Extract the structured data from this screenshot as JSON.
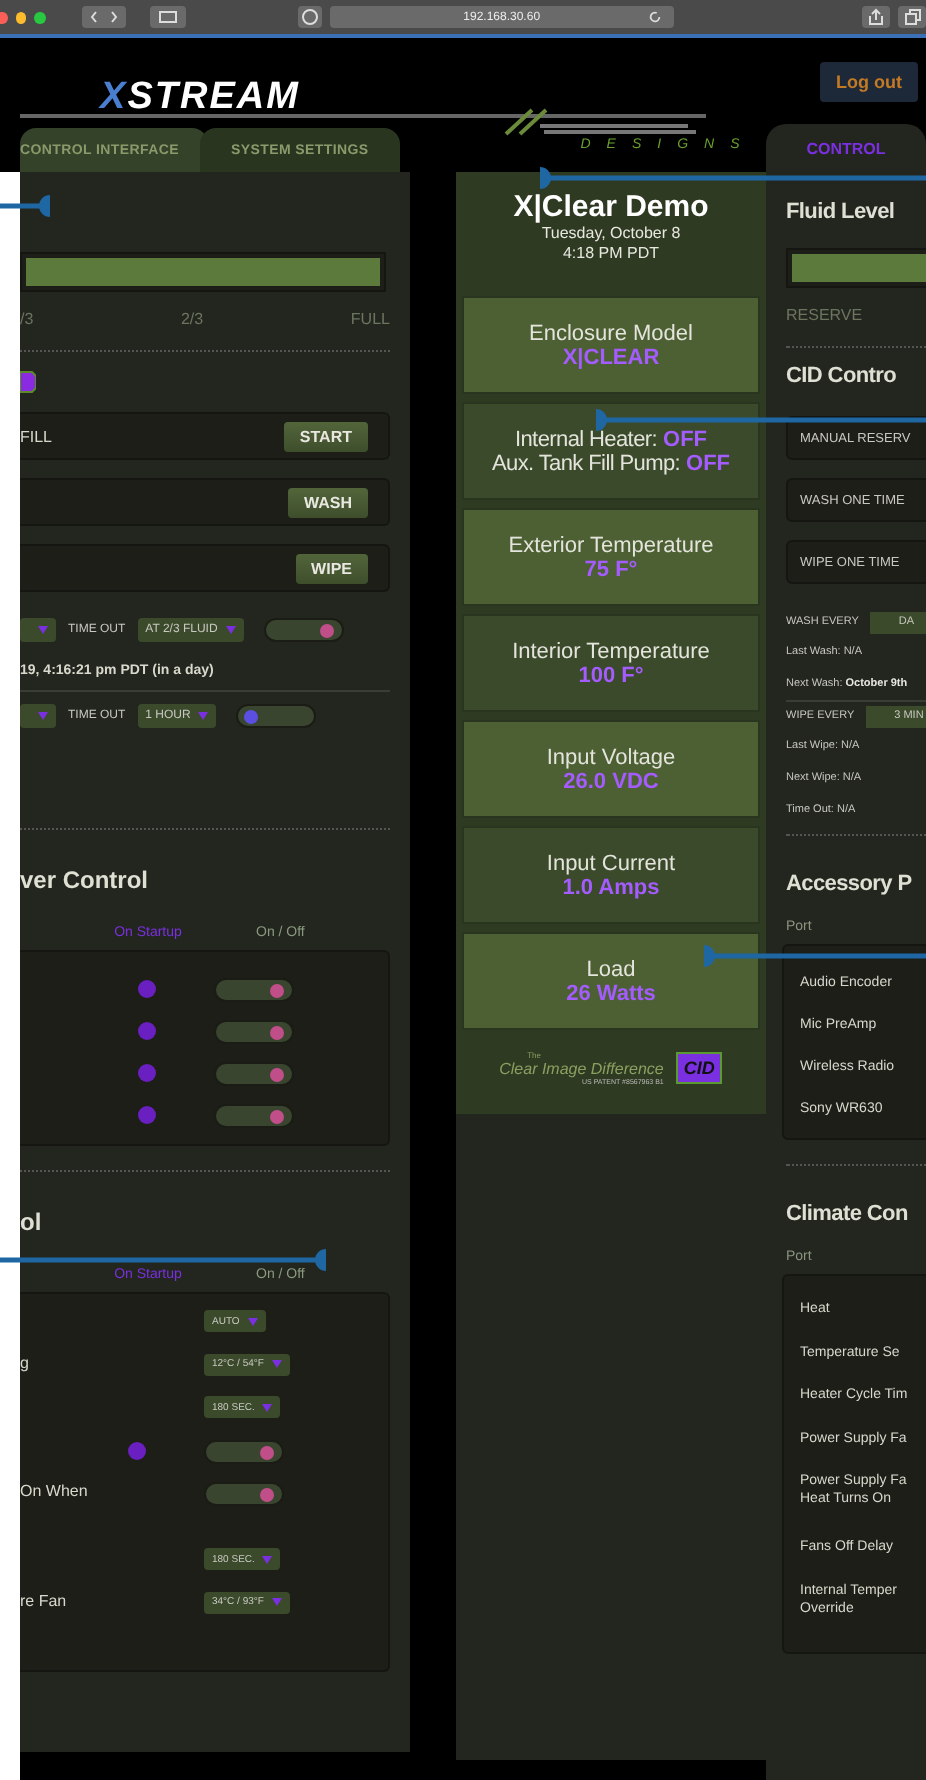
{
  "browser": {
    "address": "192.168.30.60"
  },
  "header": {
    "logo": "XSTREAM",
    "logout_button": "Log out",
    "partner_logo": "DESIGNS"
  },
  "tabs": [
    {
      "label": "CONTROL INTERFACE",
      "selected": true
    },
    {
      "label": "SYSTEM SETTINGS",
      "selected": false
    }
  ],
  "left_panel": {
    "fluid_level": {
      "level": 1,
      "marks": [
        "/3",
        "2/3",
        "FULL"
      ]
    },
    "actions": [
      {
        "label": "FILL",
        "button": "START"
      },
      {
        "button": "WASH"
      },
      {
        "button": "WIPE"
      }
    ],
    "wash_schedule": {
      "timeout_label": "TIME OUT",
      "timeout": "AT 2/3 FLUID",
      "on": true
    },
    "next_wash": "19, 4:16:21 pm PDT (in a day)",
    "wipe_schedule": {
      "timeout_label": "TIME OUT",
      "timeout": "1 HOUR",
      "on": false
    },
    "power": {
      "heading": "ver Control",
      "columns": [
        "On Startup",
        "On / Off"
      ],
      "rows": [
        {
          "startup": true,
          "on": true
        },
        {
          "startup": true,
          "on": true
        },
        {
          "startup": true,
          "on": true
        },
        {
          "startup": true,
          "on": true
        }
      ]
    },
    "climate": {
      "heading": "ol",
      "columns": [
        "On Startup",
        "On / Off"
      ],
      "rows": [
        {
          "kind": "dropdown",
          "value": "AUTO"
        },
        {
          "kind": "dropdown",
          "label": "g",
          "value": "12°C / 54°F"
        },
        {
          "kind": "dropdown",
          "value": "180 SEC."
        },
        {
          "kind": "toggle",
          "startup": true,
          "on": true
        },
        {
          "kind": "toggle",
          "label": "On When",
          "startup": false,
          "on": true
        },
        {
          "kind": "dropdown",
          "value": "180 SEC."
        },
        {
          "kind": "dropdown",
          "label": "re Fan",
          "value": "34°C / 93°F"
        }
      ]
    }
  },
  "status": {
    "title": "X|Clear Demo",
    "date": "Tuesday, October 8",
    "time": "4:18 PM PDT",
    "cards": [
      {
        "kind": "value",
        "label": "Enclosure Model",
        "value": "X|CLEAR"
      },
      {
        "kind": "status",
        "items": [
          {
            "label": "Internal Heater:",
            "value": "OFF"
          },
          {
            "label": "Aux. Tank Fill Pump:",
            "value": "OFF"
          }
        ]
      },
      {
        "kind": "value",
        "label": "Exterior Temperature",
        "value": "75 F°"
      },
      {
        "kind": "value",
        "label": "Interior Temperature",
        "value": "100 F°"
      },
      {
        "kind": "value",
        "label": "Input Voltage",
        "value": "26.0 VDC"
      },
      {
        "kind": "value",
        "label": "Input Current",
        "value": "1.0 Amps"
      },
      {
        "kind": "value",
        "label": "Load",
        "value": "26 Watts"
      }
    ],
    "footer": {
      "prefix": "The",
      "slogan": "Clear Image Difference",
      "patent": "US PATENT #8567963 B1",
      "badge": "CID"
    }
  },
  "right_panel": {
    "tab": {
      "label": "CONTROL",
      "selected": true
    },
    "fluid_heading": "Fluid Level",
    "fluid_level": {
      "level": 1,
      "marks": [
        "RESERVE"
      ]
    },
    "cid_heading": "CID Contro",
    "buttons": [
      "MANUAL RESERV",
      "WASH ONE TIME",
      "WIPE ONE TIME"
    ],
    "wash_every": {
      "label": "WASH EVERY",
      "value": "DA"
    },
    "wash_info": [
      "Last Wash: N/A",
      "Next Wash: **October 9th**"
    ],
    "wipe_every": {
      "label": "WIPE EVERY",
      "value": "3 MIN"
    },
    "wipe_info": [
      "Last Wipe: N/A",
      "Next Wipe: N/A",
      "Time Out: N/A"
    ],
    "accessory": {
      "heading": "Accessory P",
      "column": "Port",
      "items": [
        "Audio Encoder",
        "Mic PreAmp",
        "Wireless Radio",
        "Sony WR630"
      ]
    },
    "climate": {
      "heading": "Climate Con",
      "column": "Port",
      "items": [
        [
          "Heat"
        ],
        [
          "Temperature Se"
        ],
        [
          "Heater Cycle Tim"
        ],
        [
          "Power Supply Fa"
        ],
        [
          "Power Supply Fa",
          "Heat Turns On"
        ],
        [
          "Fans Off Delay"
        ],
        [
          "Internal Temper",
          "Override"
        ]
      ]
    }
  }
}
